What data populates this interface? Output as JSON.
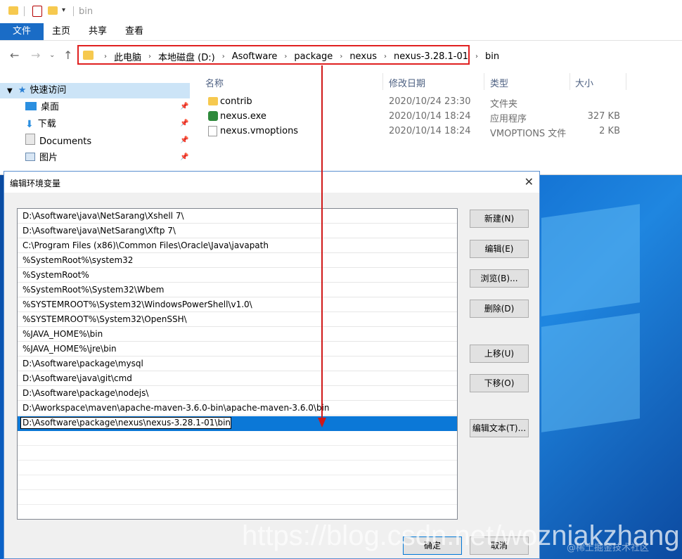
{
  "explorer": {
    "title": "bin",
    "ribbon_tabs": [
      "文件",
      "主页",
      "共享",
      "查看"
    ],
    "breadcrumbs": [
      "此电脑",
      "本地磁盘 (D:)",
      "Asoftware",
      "package",
      "nexus",
      "nexus-3.28.1-01",
      "bin"
    ],
    "nav": {
      "quick_access": "快速访问",
      "items": [
        "桌面",
        "下载",
        "Documents",
        "图片"
      ]
    },
    "columns": [
      "名称",
      "修改日期",
      "类型",
      "大小"
    ],
    "files": [
      {
        "name": "contrib",
        "date": "2020/10/24 23:30",
        "type": "文件夹",
        "size": "",
        "icon": "folder-icon"
      },
      {
        "name": "nexus.exe",
        "date": "2020/10/14 18:24",
        "type": "应用程序",
        "size": "327 KB",
        "icon": "app-icon"
      },
      {
        "name": "nexus.vmoptions",
        "date": "2020/10/14 18:24",
        "type": "VMOPTIONS 文件",
        "size": "2 KB",
        "icon": "file-icon"
      }
    ]
  },
  "dialog": {
    "title": "编辑环境变量",
    "paths": [
      "D:\\Asoftware\\java\\NetSarang\\Xshell 7\\",
      "D:\\Asoftware\\java\\NetSarang\\Xftp 7\\",
      "C:\\Program Files (x86)\\Common Files\\Oracle\\Java\\javapath",
      "%SystemRoot%\\system32",
      "%SystemRoot%",
      "%SystemRoot%\\System32\\Wbem",
      "%SYSTEMROOT%\\System32\\WindowsPowerShell\\v1.0\\",
      "%SYSTEMROOT%\\System32\\OpenSSH\\",
      "%JAVA_HOME%\\bin",
      "%JAVA_HOME%\\jre\\bin",
      "D:\\Asoftware\\package\\mysql",
      "D:\\Asoftware\\java\\git\\cmd",
      "D:\\Asoftware\\package\\nodejs\\",
      "D:\\Aworkspace\\maven\\apache-maven-3.6.0-bin\\apache-maven-3.6.0\\bin"
    ],
    "editing_value": "D:\\Asoftware\\package\\nexus\\nexus-3.28.1-01\\bin",
    "buttons": {
      "new": "新建(N)",
      "edit": "编辑(E)",
      "browse": "浏览(B)...",
      "delete": "删除(D)",
      "move_up": "上移(U)",
      "move_down": "下移(O)",
      "edit_text": "编辑文本(T)...",
      "ok": "确定",
      "cancel": "取消"
    }
  },
  "watermark": "https://blog.csdn.net/wozniakzhang",
  "watermark_small": "@稀土掘金技术社区",
  "colors": {
    "accent": "#0b78d7",
    "highlight_border": "#e02020",
    "arrow": "#d01818"
  }
}
